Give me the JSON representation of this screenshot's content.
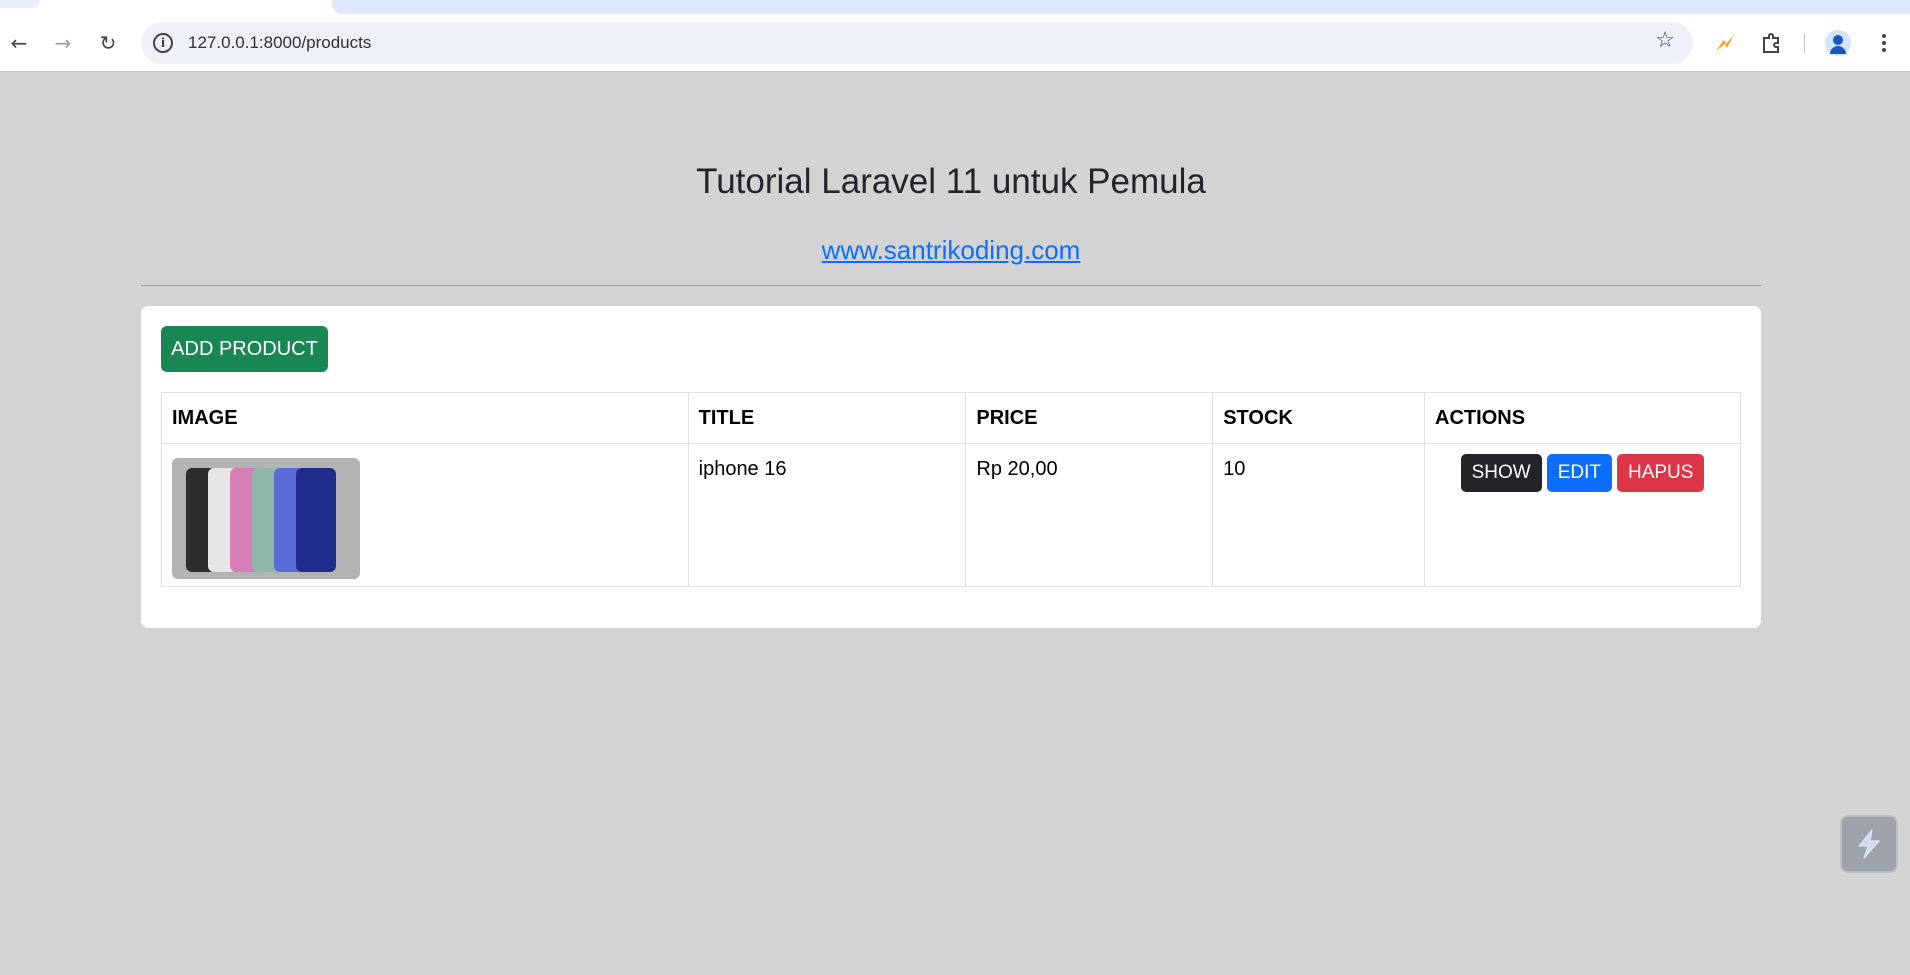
{
  "browser": {
    "url": "127.0.0.1:8000/products",
    "icons": [
      "back-arrow-icon",
      "forward-arrow-icon",
      "reload-icon",
      "site-info-icon",
      "bookmark-star-icon",
      "extension-lightning-icon",
      "extensions-puzzle-icon",
      "profile-avatar-icon",
      "kebab-menu-icon"
    ]
  },
  "page": {
    "title": "Tutorial Laravel 11 untuk Pemula",
    "link_text": "www.santrikoding.com"
  },
  "toolbar": {
    "add_label": "ADD PRODUCT"
  },
  "table": {
    "headers": [
      "IMAGE",
      "TITLE",
      "PRICE",
      "STOCK",
      "ACTIONS"
    ],
    "rows": [
      {
        "image": "iphone-16-product-image",
        "title": "iphone 16",
        "price": "Rp 20,00",
        "stock": "10",
        "actions": {
          "show": "SHOW",
          "edit": "EDIT",
          "delete": "HAPUS"
        }
      }
    ]
  },
  "colors": {
    "page_bg": "#d3d3d3",
    "add_button": "#198754",
    "show_button": "#212529",
    "edit_button": "#0d6efd",
    "delete_button": "#dc3545",
    "link": "#0d6efd"
  }
}
